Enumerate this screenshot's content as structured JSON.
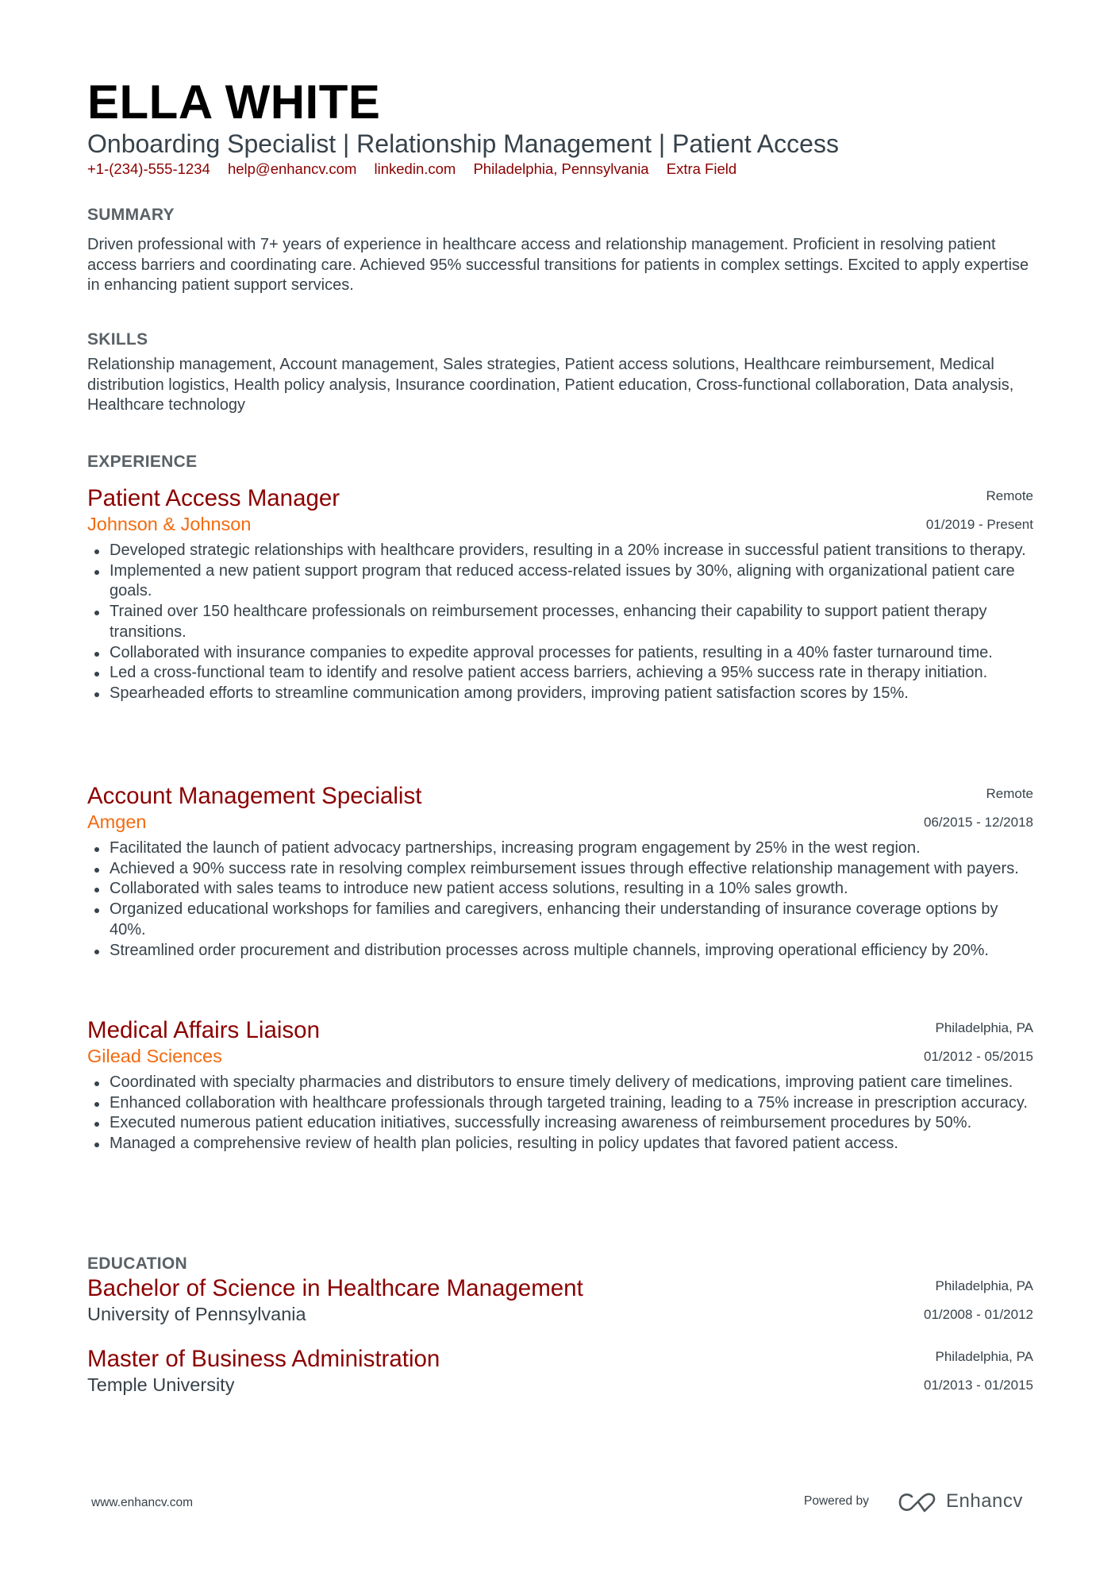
{
  "header": {
    "name": "ELLA WHITE",
    "subtitle": "Onboarding Specialist | Relationship Management | Patient Access",
    "contact": [
      "+1-(234)-555-1234",
      "help@enhancv.com",
      "linkedin.com",
      "Philadelphia, Pennsylvania",
      "Extra Field"
    ]
  },
  "summary": {
    "title": "SUMMARY",
    "text": "Driven professional with 7+ years of experience in healthcare access and relationship management. Proficient in resolving patient access barriers and coordinating care. Achieved 95% successful transitions for patients in complex settings. Excited to apply expertise in enhancing patient support services."
  },
  "skills": {
    "title": "SKILLS",
    "text": "Relationship management, Account management, Sales strategies, Patient access solutions, Healthcare reimbursement, Medical distribution logistics, Health policy analysis, Insurance coordination, Patient education, Cross-functional collaboration, Data analysis, Healthcare technology"
  },
  "experience": {
    "title": "EXPERIENCE",
    "jobs": [
      {
        "title": "Patient Access Manager",
        "company": "Johnson & Johnson",
        "location": "Remote",
        "dates": "01/2019 - Present",
        "bullets": [
          "Developed strategic relationships with healthcare providers, resulting in a 20% increase in successful patient transitions to therapy.",
          "Implemented a new patient support program that reduced access-related issues by 30%, aligning with organizational patient care goals.",
          "Trained over 150 healthcare professionals on reimbursement processes, enhancing their capability to support patient therapy transitions.",
          "Collaborated with insurance companies to expedite approval processes for patients, resulting in a 40% faster turnaround time.",
          "Led a cross-functional team to identify and resolve patient access barriers, achieving a 95% success rate in therapy initiation.",
          "Spearheaded efforts to streamline communication among providers, improving patient satisfaction scores by 15%."
        ]
      },
      {
        "title": "Account Management Specialist",
        "company": "Amgen",
        "location": "Remote",
        "dates": "06/2015 - 12/2018",
        "bullets": [
          "Facilitated the launch of patient advocacy partnerships, increasing program engagement by 25% in the west region.",
          "Achieved a 90% success rate in resolving complex reimbursement issues through effective relationship management with payers.",
          "Collaborated with sales teams to introduce new patient access solutions, resulting in a 10% sales growth.",
          "Organized educational workshops for families and caregivers, enhancing their understanding of insurance coverage options by 40%.",
          "Streamlined order procurement and distribution processes across multiple channels, improving operational efficiency by 20%."
        ]
      },
      {
        "title": "Medical Affairs Liaison",
        "company": "Gilead Sciences",
        "location": "Philadelphia, PA",
        "dates": "01/2012 - 05/2015",
        "bullets": [
          "Coordinated with specialty pharmacies and distributors to ensure timely delivery of medications, improving patient care timelines.",
          "Enhanced collaboration with healthcare professionals through targeted training, leading to a 75% increase in prescription accuracy.",
          "Executed numerous patient education initiatives, successfully increasing awareness of reimbursement procedures by 50%.",
          "Managed a comprehensive review of health plan policies, resulting in policy updates that favored patient access."
        ]
      }
    ]
  },
  "education": {
    "title": "EDUCATION",
    "items": [
      {
        "degree": "Bachelor of Science in Healthcare Management",
        "school": "University of Pennsylvania",
        "location": "Philadelphia, PA",
        "dates": "01/2008 - 01/2012"
      },
      {
        "degree": "Master of Business Administration",
        "school": "Temple University",
        "location": "Philadelphia, PA",
        "dates": "01/2013 - 01/2015"
      }
    ]
  },
  "footer": {
    "url": "www.enhancv.com",
    "powered_by": "Powered by",
    "brand": "Enhancv",
    "logo_icon": "enhancv-logo-icon"
  },
  "colors": {
    "name": "#000000",
    "accent_title": "#8b0000",
    "accent_company": "#f26b10",
    "section_heading": "#5a6166",
    "body_text": "#37424a"
  }
}
